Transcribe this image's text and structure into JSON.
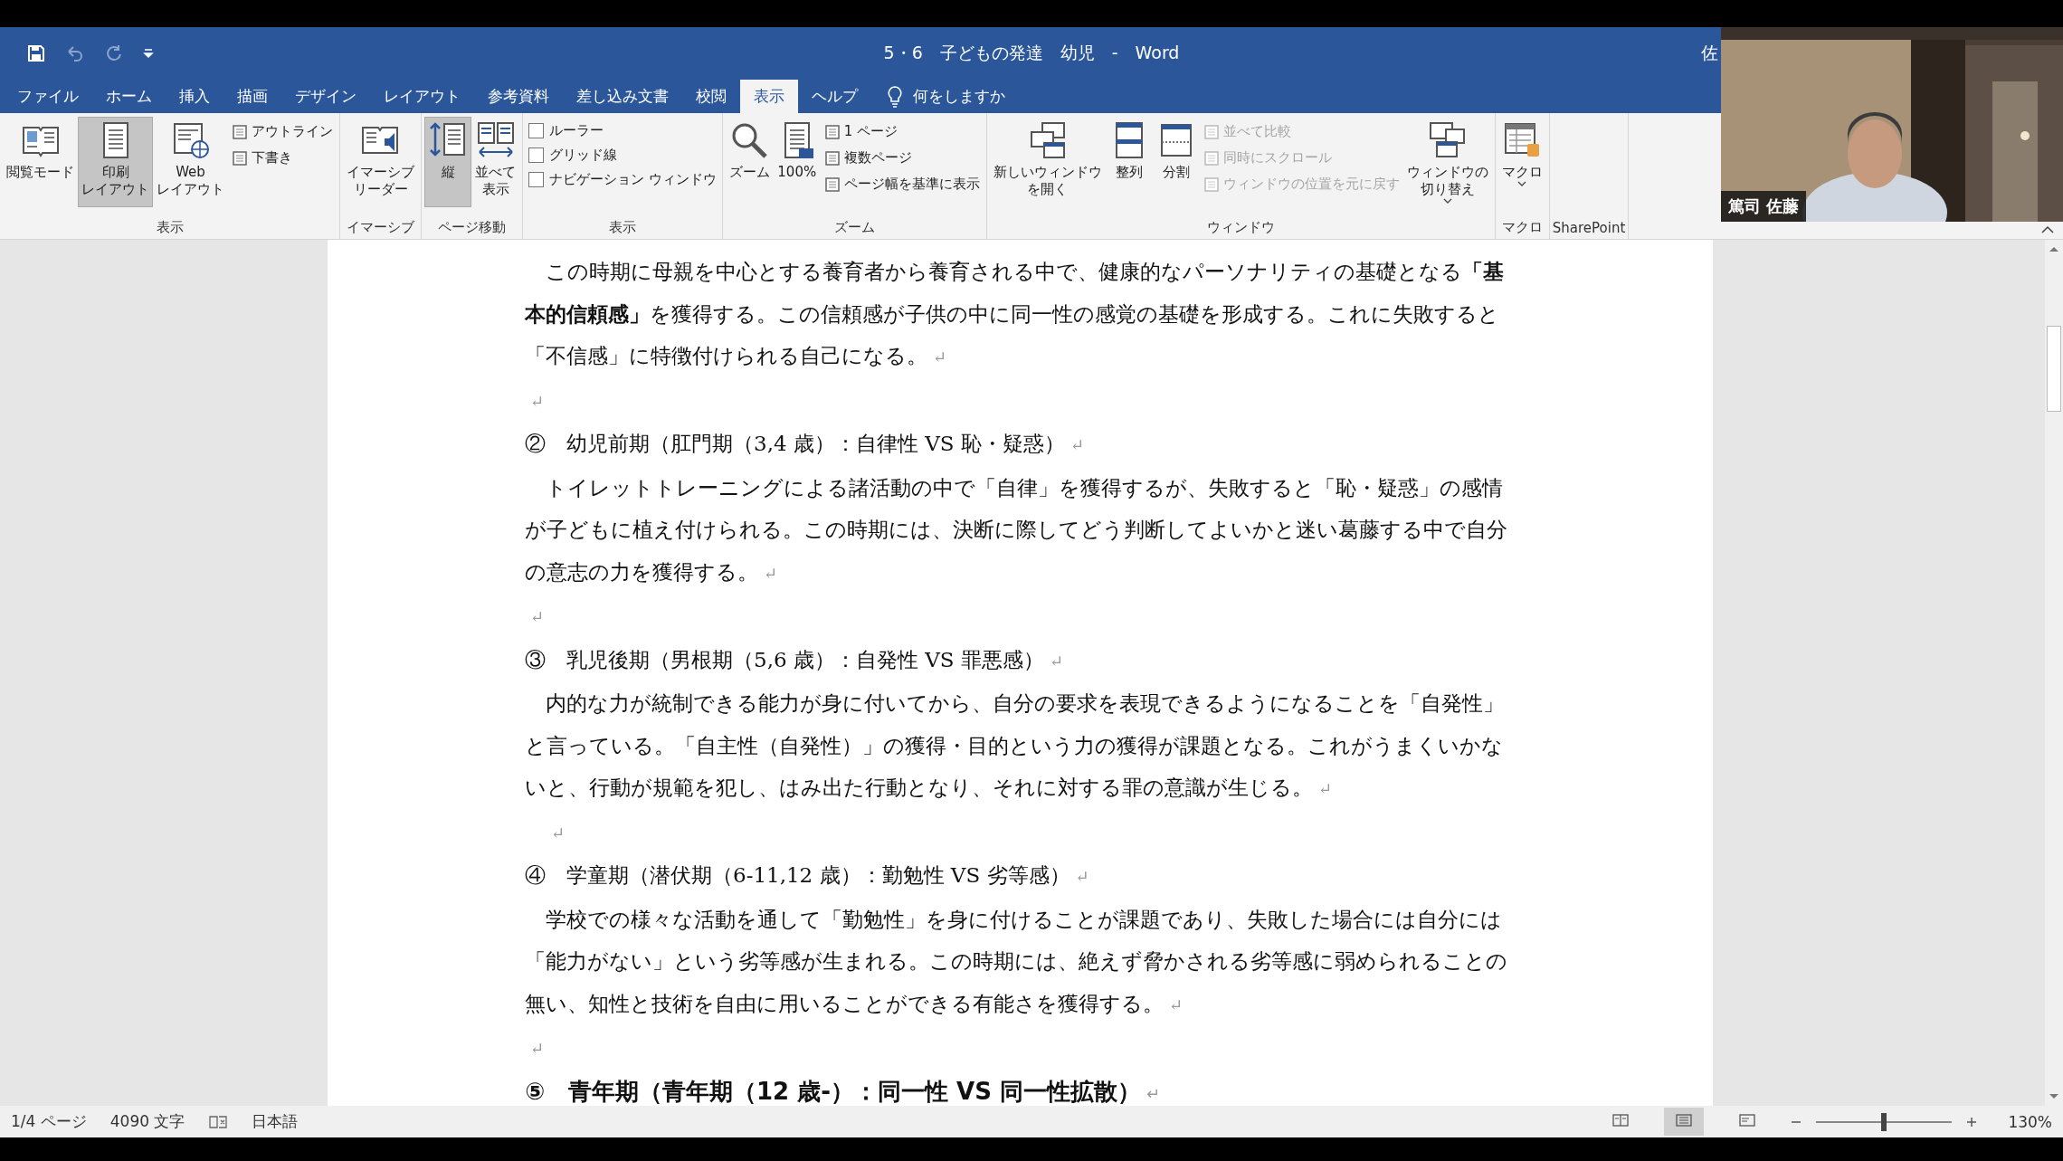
{
  "title_bar": {
    "document_title": "5・6　子どもの発達　幼児　-　Word",
    "account_name": "佐"
  },
  "tabs": [
    {
      "label": "ファイル",
      "selected": false
    },
    {
      "label": "ホーム",
      "selected": false
    },
    {
      "label": "挿入",
      "selected": false
    },
    {
      "label": "描画",
      "selected": false
    },
    {
      "label": "デザイン",
      "selected": false
    },
    {
      "label": "レイアウト",
      "selected": false
    },
    {
      "label": "参考資料",
      "selected": false
    },
    {
      "label": "差し込み文書",
      "selected": false
    },
    {
      "label": "校閲",
      "selected": false
    },
    {
      "label": "表示",
      "selected": true
    },
    {
      "label": "ヘルプ",
      "selected": false
    }
  ],
  "tell_me": {
    "placeholder": "何をしますか"
  },
  "ribbon_groups": [
    {
      "label": "表示",
      "items": [
        {
          "kind": "large",
          "label_lines": [
            "閲覧モード"
          ],
          "selected": false
        },
        {
          "kind": "large",
          "label_lines": [
            "印刷",
            "レイアウト"
          ],
          "selected": true
        },
        {
          "kind": "large",
          "label_lines": [
            "Web",
            "レイアウト"
          ],
          "selected": false
        },
        {
          "kind": "small",
          "label": "アウトライン",
          "selected": false
        },
        {
          "kind": "small",
          "label": "下書き",
          "selected": false
        }
      ]
    },
    {
      "label": "イマーシブ",
      "items": [
        {
          "kind": "large",
          "label_lines": [
            "イマーシブ",
            "リーダー"
          ]
        }
      ]
    },
    {
      "label": "ページ移動",
      "items": [
        {
          "kind": "large",
          "label_lines": [
            "縦"
          ],
          "selected": true
        },
        {
          "kind": "large",
          "label_lines": [
            "並べて",
            "表示"
          ],
          "selected": false
        }
      ]
    },
    {
      "label": "表示",
      "items": [
        {
          "kind": "checkbox",
          "label": "ルーラー",
          "checked": false
        },
        {
          "kind": "checkbox",
          "label": "グリッド線",
          "checked": false
        },
        {
          "kind": "checkbox",
          "label": "ナビゲーション ウィンドウ",
          "checked": false
        }
      ]
    },
    {
      "label": "ズーム",
      "items": [
        {
          "kind": "large",
          "label_lines": [
            "ズーム"
          ]
        },
        {
          "kind": "large",
          "label_lines": [
            "100%"
          ]
        },
        {
          "kind": "small",
          "label": "1 ページ"
        },
        {
          "kind": "small",
          "label": "複数ページ"
        },
        {
          "kind": "small",
          "label": "ページ幅を基準に表示"
        }
      ]
    },
    {
      "label": "ウィンドウ",
      "items": [
        {
          "kind": "large",
          "label_lines": [
            "新しいウィンドウ",
            "を開く"
          ],
          "disabled": false
        },
        {
          "kind": "large",
          "label_lines": [
            "整列"
          ],
          "disabled": false
        },
        {
          "kind": "large",
          "label_lines": [
            "分割"
          ],
          "disabled": false
        },
        {
          "kind": "small",
          "label": "並べて比較",
          "disabled": true
        },
        {
          "kind": "small",
          "label": "同時にスクロール",
          "disabled": true
        },
        {
          "kind": "small",
          "label": "ウィンドウの位置を元に戻す",
          "disabled": true
        },
        {
          "kind": "large",
          "label_lines": [
            "ウィンドウの",
            "切り替え"
          ],
          "dropdown": true
        }
      ]
    },
    {
      "label": "マクロ",
      "items": [
        {
          "kind": "large",
          "label_lines": [
            "マクロ"
          ],
          "dropdown": true
        }
      ]
    },
    {
      "label": "SharePoint"
    }
  ],
  "document": {
    "paragraphs": [
      {
        "kind": "body",
        "text": "この時期に母親を中心とする養育者から養育される中で、健康的なパーソナリティの基礎となる**「基本的信頼感」**を獲得する。この信頼感が子供の中に同一性の感覚の基礎を形成する。これに失敗すると「不信感」に特徴付けられる自己になる。",
        "mark": "↵"
      },
      {
        "kind": "empty",
        "mark": "↵"
      },
      {
        "kind": "heading",
        "text": "②　幼児前期（肛門期（3,4 歳）：自律性 VS 恥・疑惑）",
        "mark": "↵"
      },
      {
        "kind": "body",
        "text": "トイレットトレーニングによる諸活動の中で「自律」を獲得するが、失敗すると「恥・疑惑」の感情が子どもに植え付けられる。この時期には、決断に際してどう判断してよいかと迷い葛藤する中で自分の意志の力を獲得する。",
        "mark": "↵"
      },
      {
        "kind": "empty",
        "mark": "↵"
      },
      {
        "kind": "heading",
        "text": "③　乳児後期（男根期（5,6 歳）：自発性 VS 罪悪感）",
        "mark": "↵"
      },
      {
        "kind": "body",
        "text": "内的な力が統制できる能力が身に付いてから、自分の要求を表現できるようになることを「自発性」と言っている。「自主性（自発性）」の獲得・目的という力の獲得が課題となる。これがうまくいかないと、行動が規範を犯し、はみ出た行動となり、それに対する罪の意識が生じる。",
        "mark": "↵"
      },
      {
        "kind": "empty_indented",
        "mark": "↵"
      },
      {
        "kind": "heading",
        "text": "④　学童期（潜伏期（6-11,12 歳）：勤勉性 VS 劣等感）",
        "mark": "↵"
      },
      {
        "kind": "body",
        "text": "学校での様々な活動を通して「勤勉性」を身に付けることが課題であり、失敗した場合には自分には「能力がない」という劣等感が生まれる。この時期には、絶えず脅かされる劣等感に弱められることの無い、知性と技術を自由に用いることができる有能さを獲得する。",
        "mark": "↵"
      },
      {
        "kind": "empty",
        "mark": "↵"
      },
      {
        "kind": "heading_bold",
        "text": "⑤　青年期（青年期（12 歳-）：同一性 VS 同一性拡散）",
        "mark": "↵"
      }
    ]
  },
  "video": {
    "kind": "picture",
    "name_tag": "篤司 佐藤"
  },
  "status_bar": {
    "page": "1/4 ページ",
    "words": "4090 文字",
    "language": "日本語",
    "zoom": "130%",
    "zoom_slider": {
      "level": 0.5
    },
    "views": [
      {
        "selected": false
      },
      {
        "selected": true
      },
      {
        "selected": false
      }
    ]
  }
}
